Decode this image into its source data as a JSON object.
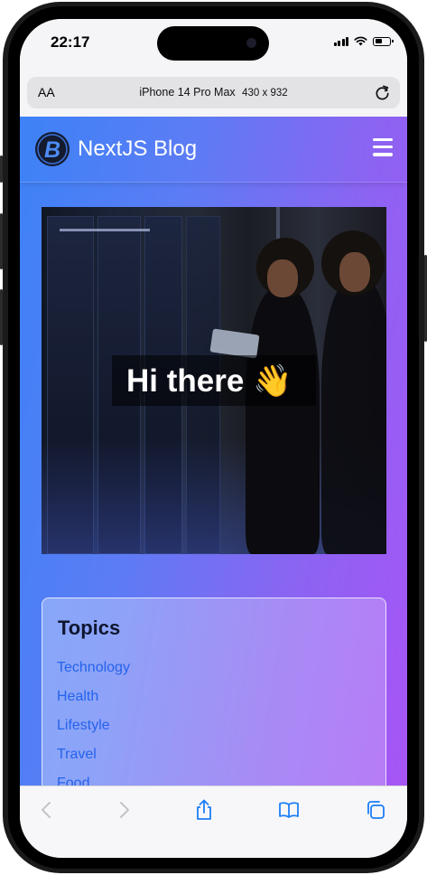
{
  "status_bar": {
    "time": "22:17"
  },
  "browser": {
    "text_size_label": "AA",
    "device_name": "iPhone 14 Pro Max",
    "dimensions": "430 x 932"
  },
  "site": {
    "brand": "NextJS Blog",
    "hero_greeting": "Hi there 👋",
    "topics": {
      "title": "Topics",
      "items": [
        "Technology",
        "Health",
        "Lifestyle",
        "Travel",
        "Food"
      ]
    }
  },
  "colors": {
    "gradient_start": "#3d82f6",
    "gradient_end": "#a755f5",
    "topic_link": "#2563eb",
    "ios_blue": "#1e7ef5"
  },
  "icons": {
    "menu": "hamburger-icon",
    "reload": "reload-icon",
    "back": "chevron-left-icon",
    "forward": "chevron-right-icon",
    "share": "share-icon",
    "bookmarks": "book-icon",
    "tabs": "tabs-icon"
  }
}
